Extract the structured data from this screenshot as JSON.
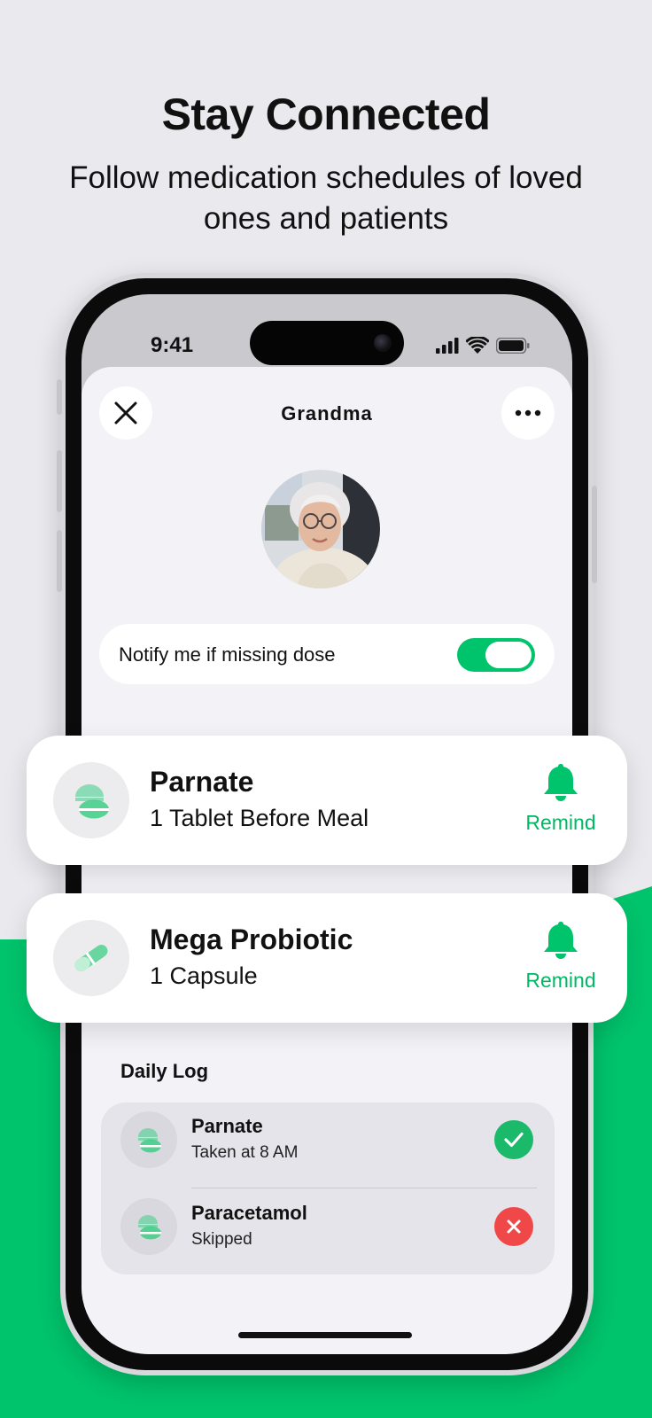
{
  "colors": {
    "accent": "#00c46c",
    "accent_text": "#00b864",
    "success": "#1bb96a",
    "danger": "#f04848",
    "background": "#e9e9ee"
  },
  "headline": "Stay Connected",
  "subheadline": "Follow medication schedules of loved ones and patients",
  "status_bar": {
    "time": "9:41",
    "icons": [
      "cellular-signal-icon",
      "wifi-icon",
      "battery-icon"
    ]
  },
  "profile": {
    "title": "Grandma",
    "close_icon": "close-icon",
    "more_icon": "more-icon"
  },
  "notify": {
    "label": "Notify me if missing dose",
    "enabled": true
  },
  "medications": [
    {
      "name": "Parnate",
      "dose": "1 Tablet Before Meal",
      "icon": "tablet-icon",
      "action": "Remind"
    },
    {
      "name": "Mega Probiotic",
      "dose": "1 Capsule",
      "icon": "capsule-icon",
      "action": "Remind"
    }
  ],
  "daily_log": {
    "title": "Daily Log",
    "entries": [
      {
        "name": "Parnate",
        "status": "Taken at 8 AM",
        "result": "taken"
      },
      {
        "name": "Paracetamol",
        "status": "Skipped",
        "result": "skipped"
      }
    ]
  }
}
